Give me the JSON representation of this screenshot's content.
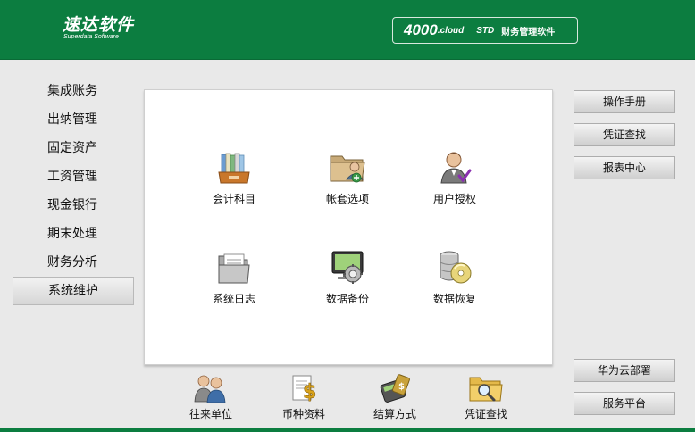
{
  "header": {
    "logo_cn": "速达软件",
    "logo_en": "Superdata Software",
    "product_version": "4000",
    "product_cloud": ".cloud",
    "product_edition": "STD",
    "product_name": "财务管理软件",
    "bg_color": "#0c7d40"
  },
  "nav": {
    "items": [
      {
        "label": "集成账务"
      },
      {
        "label": "出纳管理"
      },
      {
        "label": "固定资产"
      },
      {
        "label": "工资管理"
      },
      {
        "label": "现金银行"
      },
      {
        "label": "期末处理"
      },
      {
        "label": "财务分析"
      },
      {
        "label": "系统维护"
      }
    ],
    "active": "系统维护"
  },
  "main": {
    "tiles": [
      {
        "label": "会计科目",
        "icon": "books-tray-icon"
      },
      {
        "label": "帐套选项",
        "icon": "folder-user-icon"
      },
      {
        "label": "用户授权",
        "icon": "user-check-icon"
      },
      {
        "label": "系统日志",
        "icon": "folder-doc-icon"
      },
      {
        "label": "数据备份",
        "icon": "monitor-gear-icon"
      },
      {
        "label": "数据恢复",
        "icon": "database-disc-icon"
      }
    ]
  },
  "bottom": {
    "tiles": [
      {
        "label": "往来单位",
        "icon": "partners-icon"
      },
      {
        "label": "币种资料",
        "icon": "currency-doc-icon"
      },
      {
        "label": "结算方式",
        "icon": "card-terminal-icon"
      },
      {
        "label": "凭证查找",
        "icon": "folder-search-icon"
      }
    ]
  },
  "right": {
    "top_buttons": [
      {
        "label": "操作手册"
      },
      {
        "label": "凭证查找"
      },
      {
        "label": "报表中心"
      }
    ],
    "bottom_buttons": [
      {
        "label": "华为云部署"
      },
      {
        "label": "服务平台"
      }
    ]
  }
}
